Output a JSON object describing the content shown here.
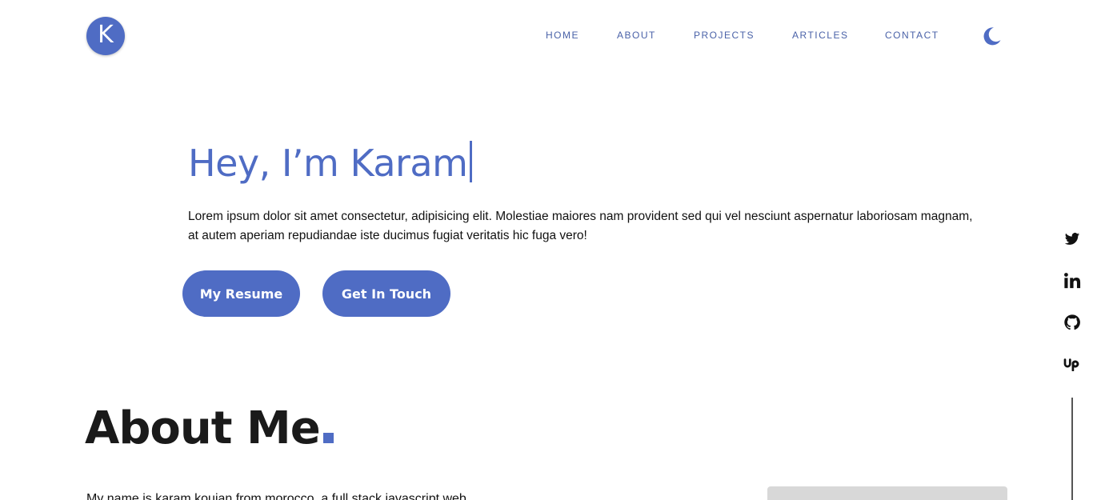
{
  "logo": {
    "letter": "K"
  },
  "nav": {
    "items": [
      {
        "label": "HOME"
      },
      {
        "label": "ABOUT"
      },
      {
        "label": "PROJECTS"
      },
      {
        "label": "ARTICLES"
      },
      {
        "label": "CONTACT"
      }
    ],
    "theme_toggle_icon": "moon-icon"
  },
  "hero": {
    "title": "Hey, I’m Karam",
    "description": "Lorem ipsum dolor sit amet consectetur, adipisicing elit. Molestiae maiores nam provident sed qui vel nesciunt aspernatur laboriosam magnam, at autem aperiam repudiandae iste ducimus fugiat veritatis hic fuga vero!",
    "buttons": {
      "resume": "My Resume",
      "contact": "Get In Touch"
    }
  },
  "social": {
    "icons": [
      "twitter-icon",
      "linkedin-icon",
      "github-icon",
      "upwork-icon"
    ]
  },
  "about": {
    "title": "About Me",
    "intro": "My name is karam koujan from morocco, a full stack javascript web"
  },
  "colors": {
    "accent": "#4f6cc4",
    "nav_text": "#4a62a8",
    "text": "#111111"
  }
}
